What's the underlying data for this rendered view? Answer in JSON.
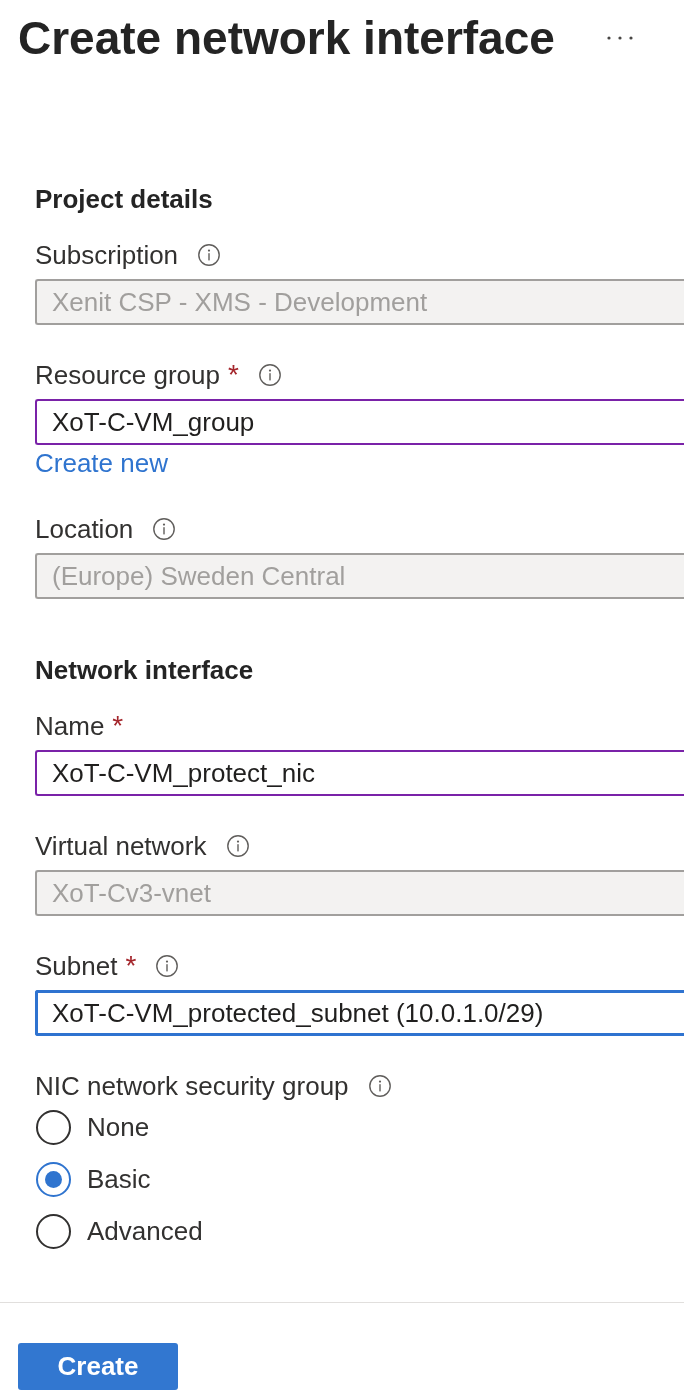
{
  "header": {
    "title": "Create network interface"
  },
  "sections": [
    {
      "heading": "Project details",
      "fields": [
        {
          "label": "Subscription",
          "info": true,
          "value": "Xenit CSP - XMS - Development",
          "disabled": true,
          "modified": false,
          "focused": false
        },
        {
          "label": "Resource group",
          "required_mark": "*",
          "info": true,
          "value": "XoT-C-VM_group",
          "disabled": false,
          "modified": true,
          "focused": false,
          "link": "Create new"
        },
        {
          "label": "Location",
          "info": true,
          "value": "(Europe) Sweden Central",
          "disabled": true,
          "modified": false,
          "focused": false
        }
      ]
    },
    {
      "heading": "Network interface",
      "fields": [
        {
          "label": "Name",
          "required_mark": "*",
          "info": false,
          "value": "XoT-C-VM_protect_nic",
          "disabled": false,
          "modified": true,
          "focused": false
        },
        {
          "label": "Virtual network",
          "info": true,
          "value": "XoT-Cv3-vnet",
          "disabled": true,
          "modified": false,
          "focused": false
        },
        {
          "label": "Subnet",
          "required_mark": "*",
          "info": true,
          "value": "XoT-C-VM_protected_subnet (10.0.1.0/29)",
          "disabled": false,
          "modified": false,
          "focused": true
        }
      ],
      "radio_group": {
        "label": "NIC network security group",
        "info": true,
        "options": [
          {
            "label": "None",
            "selected": false
          },
          {
            "label": "Basic",
            "selected": true
          },
          {
            "label": "Advanced",
            "selected": false
          }
        ]
      }
    }
  ],
  "footer": {
    "button": "Create"
  }
}
